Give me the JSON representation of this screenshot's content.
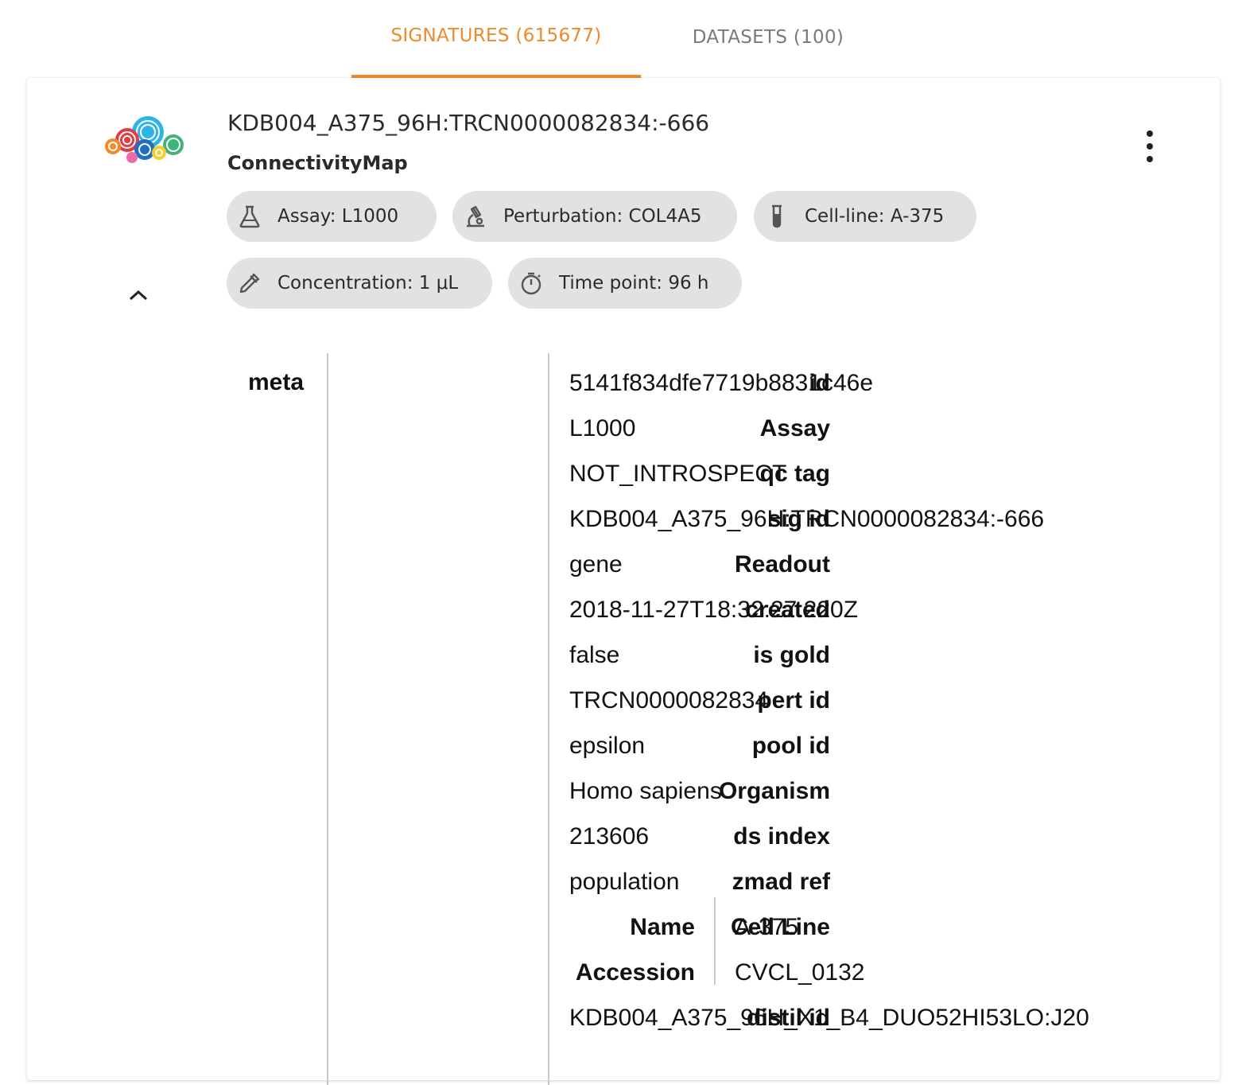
{
  "tabs": [
    {
      "label": "SIGNATURES (615677)"
    },
    {
      "label": "DATASETS (100)"
    }
  ],
  "colors": {
    "accent": "#ef8a2b",
    "chip_bg": "#e2e2e2"
  },
  "card": {
    "logo_icon": "connectivitymap-logo",
    "title": "KDB004_A375_96H:TRCN0000082834:-666",
    "subtitle": "ConnectivityMap",
    "chips": [
      {
        "icon": "flask-icon",
        "label": "Assay: L1000"
      },
      {
        "icon": "microscope-icon",
        "label": "Perturbation: COL4A5"
      },
      {
        "icon": "test-tube-icon",
        "label": "Cell-line: A-375"
      },
      {
        "icon": "pipette-icon",
        "label": "Concentration: 1 μL"
      },
      {
        "icon": "timer-icon",
        "label": "Time point: 96 h"
      }
    ]
  },
  "details": {
    "section_label": "meta",
    "rows": [
      {
        "key": "id",
        "value": "5141f834dfe7719b8831c46e"
      },
      {
        "key": "Assay",
        "value": "L1000"
      },
      {
        "key": "qc tag",
        "value": "NOT_INTROSPECT"
      },
      {
        "key": "sig id",
        "value": "KDB004_A375_96H:TRCN0000082834:-666"
      },
      {
        "key": "Readout",
        "value": "gene"
      },
      {
        "key": "created",
        "value": "2018-11-27T18:32:27.220Z"
      },
      {
        "key": "is gold",
        "value": "false"
      },
      {
        "key": "pert id",
        "value": "TRCN0000082834"
      },
      {
        "key": "pool id",
        "value": "epsilon"
      },
      {
        "key": "Organism",
        "value": "Homo sapiens"
      },
      {
        "key": "ds index",
        "value": "213606"
      },
      {
        "key": "zmad ref",
        "value": "population"
      },
      {
        "key": "Cell Line",
        "value": ""
      },
      {
        "key": "",
        "value": ""
      },
      {
        "key": "distil id",
        "value": "KDB004_A375_96H_X1_B4_DUO52HI53LO:J20"
      }
    ],
    "cell_line": [
      {
        "key": "Name",
        "value": "A-375"
      },
      {
        "key": "Accession",
        "value": "CVCL_0132"
      }
    ]
  }
}
